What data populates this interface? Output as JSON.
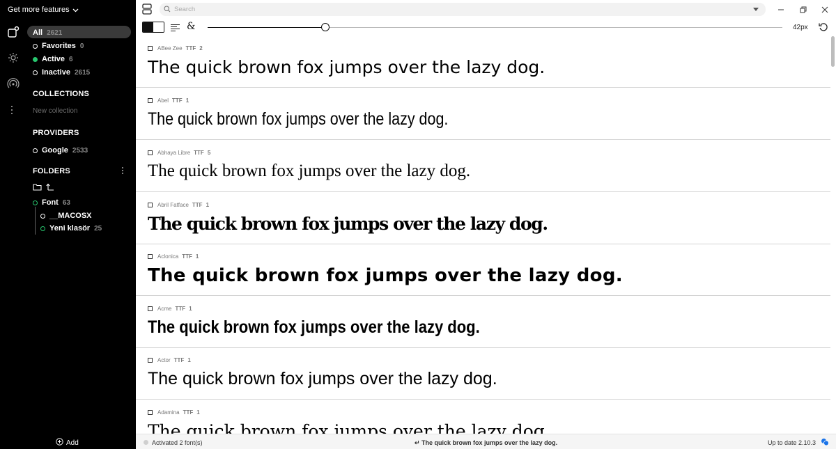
{
  "sidebar": {
    "promo_label": "Get more features",
    "filters": [
      {
        "label": "All",
        "count": "2621"
      },
      {
        "label": "Favorites",
        "count": "0"
      },
      {
        "label": "Active",
        "count": "6"
      },
      {
        "label": "Inactive",
        "count": "2615"
      }
    ],
    "collections_title": "COLLECTIONS",
    "new_collection": "New collection",
    "providers_title": "PROVIDERS",
    "providers": [
      {
        "label": "Google",
        "count": "2533"
      }
    ],
    "folders_title": "FOLDERS",
    "folders": [
      {
        "label": "Font",
        "count": "63"
      },
      {
        "label": "__MACOSX",
        "count": ""
      },
      {
        "label": "Yeni klasör",
        "count": "25"
      }
    ],
    "add_label": "Add"
  },
  "search": {
    "placeholder": "Search"
  },
  "toolbar": {
    "size_label": "42px",
    "slider_fraction": 0.205
  },
  "sample_text": "The quick brown fox jumps over the lazy dog.",
  "fonts": [
    {
      "name": "ABee Zee",
      "format": "TTF",
      "count": "2"
    },
    {
      "name": "Abel",
      "format": "TTF",
      "count": "1"
    },
    {
      "name": "Abhaya Libre",
      "format": "TTF",
      "count": "5"
    },
    {
      "name": "Abril Fatface",
      "format": "TTF",
      "count": "1"
    },
    {
      "name": "Aclonica",
      "format": "TTF",
      "count": "1"
    },
    {
      "name": "Acme",
      "format": "TTF",
      "count": "1"
    },
    {
      "name": "Actor",
      "format": "TTF",
      "count": "1"
    },
    {
      "name": "Adamina",
      "format": "TTF",
      "count": "1"
    }
  ],
  "status": {
    "activated": "Activated 2 font(s)",
    "sample": "↵ The quick brown fox jumps over the lazy dog.",
    "version": "Up to date 2.10.3"
  },
  "colors": {
    "sidebar_bg": "#000000",
    "active_green": "#28c76f",
    "selected_pill": "#3a3a3a"
  }
}
